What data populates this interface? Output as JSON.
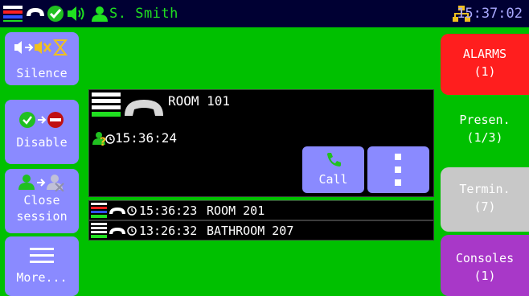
{
  "topbar": {
    "user_name": "S. Smith",
    "clock": "15:37:02",
    "icons": [
      "level-bars-icon",
      "handset-icon",
      "check-circle-icon",
      "speaker-icon",
      "user-icon",
      "network-icon"
    ]
  },
  "sidebar": {
    "silence": {
      "label": "Silence",
      "icon": "mute-icon"
    },
    "disable": {
      "label": "Disable",
      "icon": "disable-icon"
    },
    "close_session": {
      "label_line1": "Close",
      "label_line2": "session",
      "icon": "user-switch-icon"
    },
    "more": {
      "label": "More...",
      "icon": "menu-icon"
    }
  },
  "tabs": [
    {
      "line1": "ALARMS",
      "line2": "(1)",
      "color": "#FF1E1E"
    },
    {
      "line1": "Presen.",
      "line2": "(1/3)",
      "color": "#00C000"
    },
    {
      "line1": "Termin.",
      "line2": "(7)",
      "color": "#C8C8C8"
    },
    {
      "line1": "Consoles",
      "line2": "(1)",
      "color": "#A838C8"
    }
  ],
  "call_panel": {
    "room": "ROOM 101",
    "time": "15:36:24",
    "call_label": "Call"
  },
  "rows": [
    {
      "time": "15:36:23",
      "room": "ROOM 201"
    },
    {
      "time": "13:26:32",
      "room": "BATHROOM 207"
    }
  ],
  "colors": {
    "background": "#00C000",
    "topbar": "#000033",
    "button": "#8A8AFF"
  }
}
